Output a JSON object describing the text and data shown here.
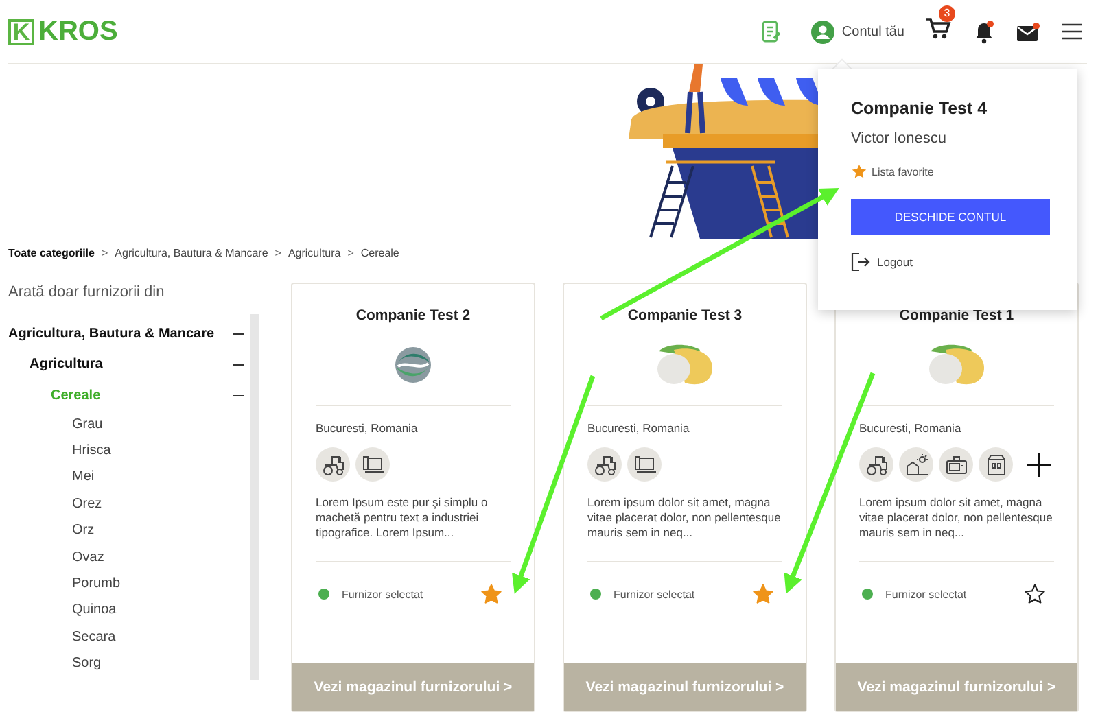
{
  "header": {
    "logo_mark": "K",
    "logo": "KROS",
    "account": "Contul tău",
    "cart_count": "3"
  },
  "account_menu": {
    "company": "Companie Test 4",
    "user": "Victor Ionescu",
    "favorites": "Lista favorite",
    "open_button": "DESCHIDE CONTUL",
    "logout": "Logout"
  },
  "breadcrumb": {
    "separator": ">",
    "items": [
      "Toate categoriile",
      "Agricultura, Bautura & Mancare",
      "Agricultura",
      "Cereale"
    ]
  },
  "filter": {
    "title": "Arată doar furnizorii din",
    "tree": [
      {
        "label": "Agricultura, Bautura & Mancare",
        "expanded": true,
        "selected": false,
        "children": [
          {
            "label": "Agricultura",
            "expanded": true,
            "selected": false,
            "children": [
              {
                "label": "Cereale",
                "expanded": true,
                "selected": true,
                "children": [
                  {
                    "label": "Grau",
                    "selected": false
                  },
                  {
                    "label": "Hrisca",
                    "selected": false
                  },
                  {
                    "label": "Mei",
                    "selected": false
                  },
                  {
                    "label": "Orez",
                    "selected": false
                  },
                  {
                    "label": "Orz",
                    "selected": false
                  },
                  {
                    "label": "Ovaz",
                    "selected": false
                  },
                  {
                    "label": "Porumb",
                    "selected": false
                  },
                  {
                    "label": "Quinoa",
                    "selected": false
                  },
                  {
                    "label": "Secara",
                    "selected": false
                  },
                  {
                    "label": "Sorg",
                    "selected": false
                  }
                ]
              }
            ]
          }
        ]
      }
    ]
  },
  "cards": [
    {
      "name": "Companie Test 2",
      "logo": {
        "kind": "swirl"
      },
      "location": "Bucuresti, Romania",
      "categories": [
        {
          "kind": "tractor"
        },
        {
          "kind": "laptop"
        }
      ],
      "more": false,
      "description": "Lorem Ipsum este pur şi simplu o machetă pentru text a industriei tipografice. Lorem Ipsum...",
      "status": "Furnizor selectat",
      "favorite": true,
      "button": "Vezi magazinul furnizorului >"
    },
    {
      "name": "Companie Test 3",
      "logo": {
        "kind": "blob"
      },
      "location": "Bucuresti, Romania",
      "categories": [
        {
          "kind": "tractor"
        },
        {
          "kind": "laptop"
        }
      ],
      "more": false,
      "description": "Lorem ipsum dolor sit amet, magna vitae placerat dolor, non pellentesque mauris sem in neq...",
      "status": "Furnizor selectat",
      "favorite": true,
      "button": "Vezi magazinul furnizorului >"
    },
    {
      "name": "Companie Test 1",
      "logo": {
        "kind": "blob"
      },
      "location": "Bucuresti, Romania",
      "categories": [
        {
          "kind": "tractor"
        },
        {
          "kind": "farm"
        },
        {
          "kind": "appliance"
        },
        {
          "kind": "factory"
        }
      ],
      "more": true,
      "description": "Lorem ipsum dolor sit amet, magna vitae placerat dolor, non pellentesque mauris sem in neq...",
      "status": "Furnizor selectat",
      "favorite": false,
      "button": "Vezi magazinul furnizorului >"
    }
  ]
}
